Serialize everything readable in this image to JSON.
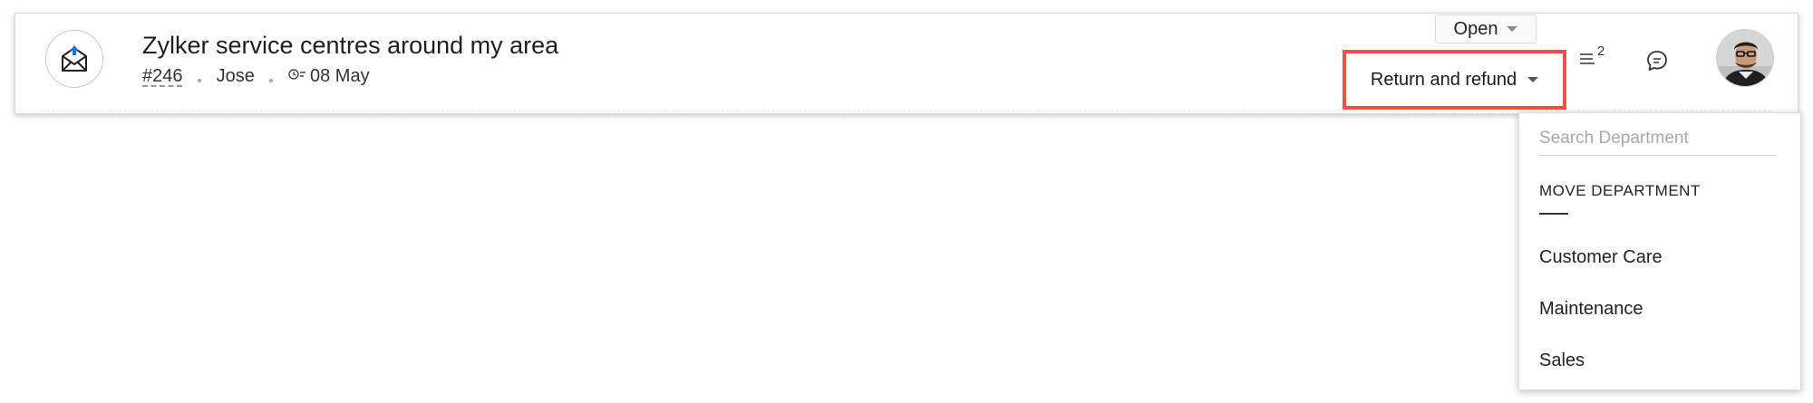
{
  "ticket": {
    "title": "Zylker service centres around my area",
    "id": "#246",
    "contact": "Jose",
    "due_date": "08 May",
    "status": "Open",
    "department": "Return and refund",
    "thread_count": "2",
    "channel_icon": "email-open-icon"
  },
  "dropdown": {
    "search_placeholder": "Search Department",
    "section_title": "MOVE DEPARTMENT",
    "options": [
      "Customer Care",
      "Maintenance",
      "Sales"
    ]
  },
  "colors": {
    "highlight": "#ee5243",
    "icon_accent": "#1a73e8"
  }
}
